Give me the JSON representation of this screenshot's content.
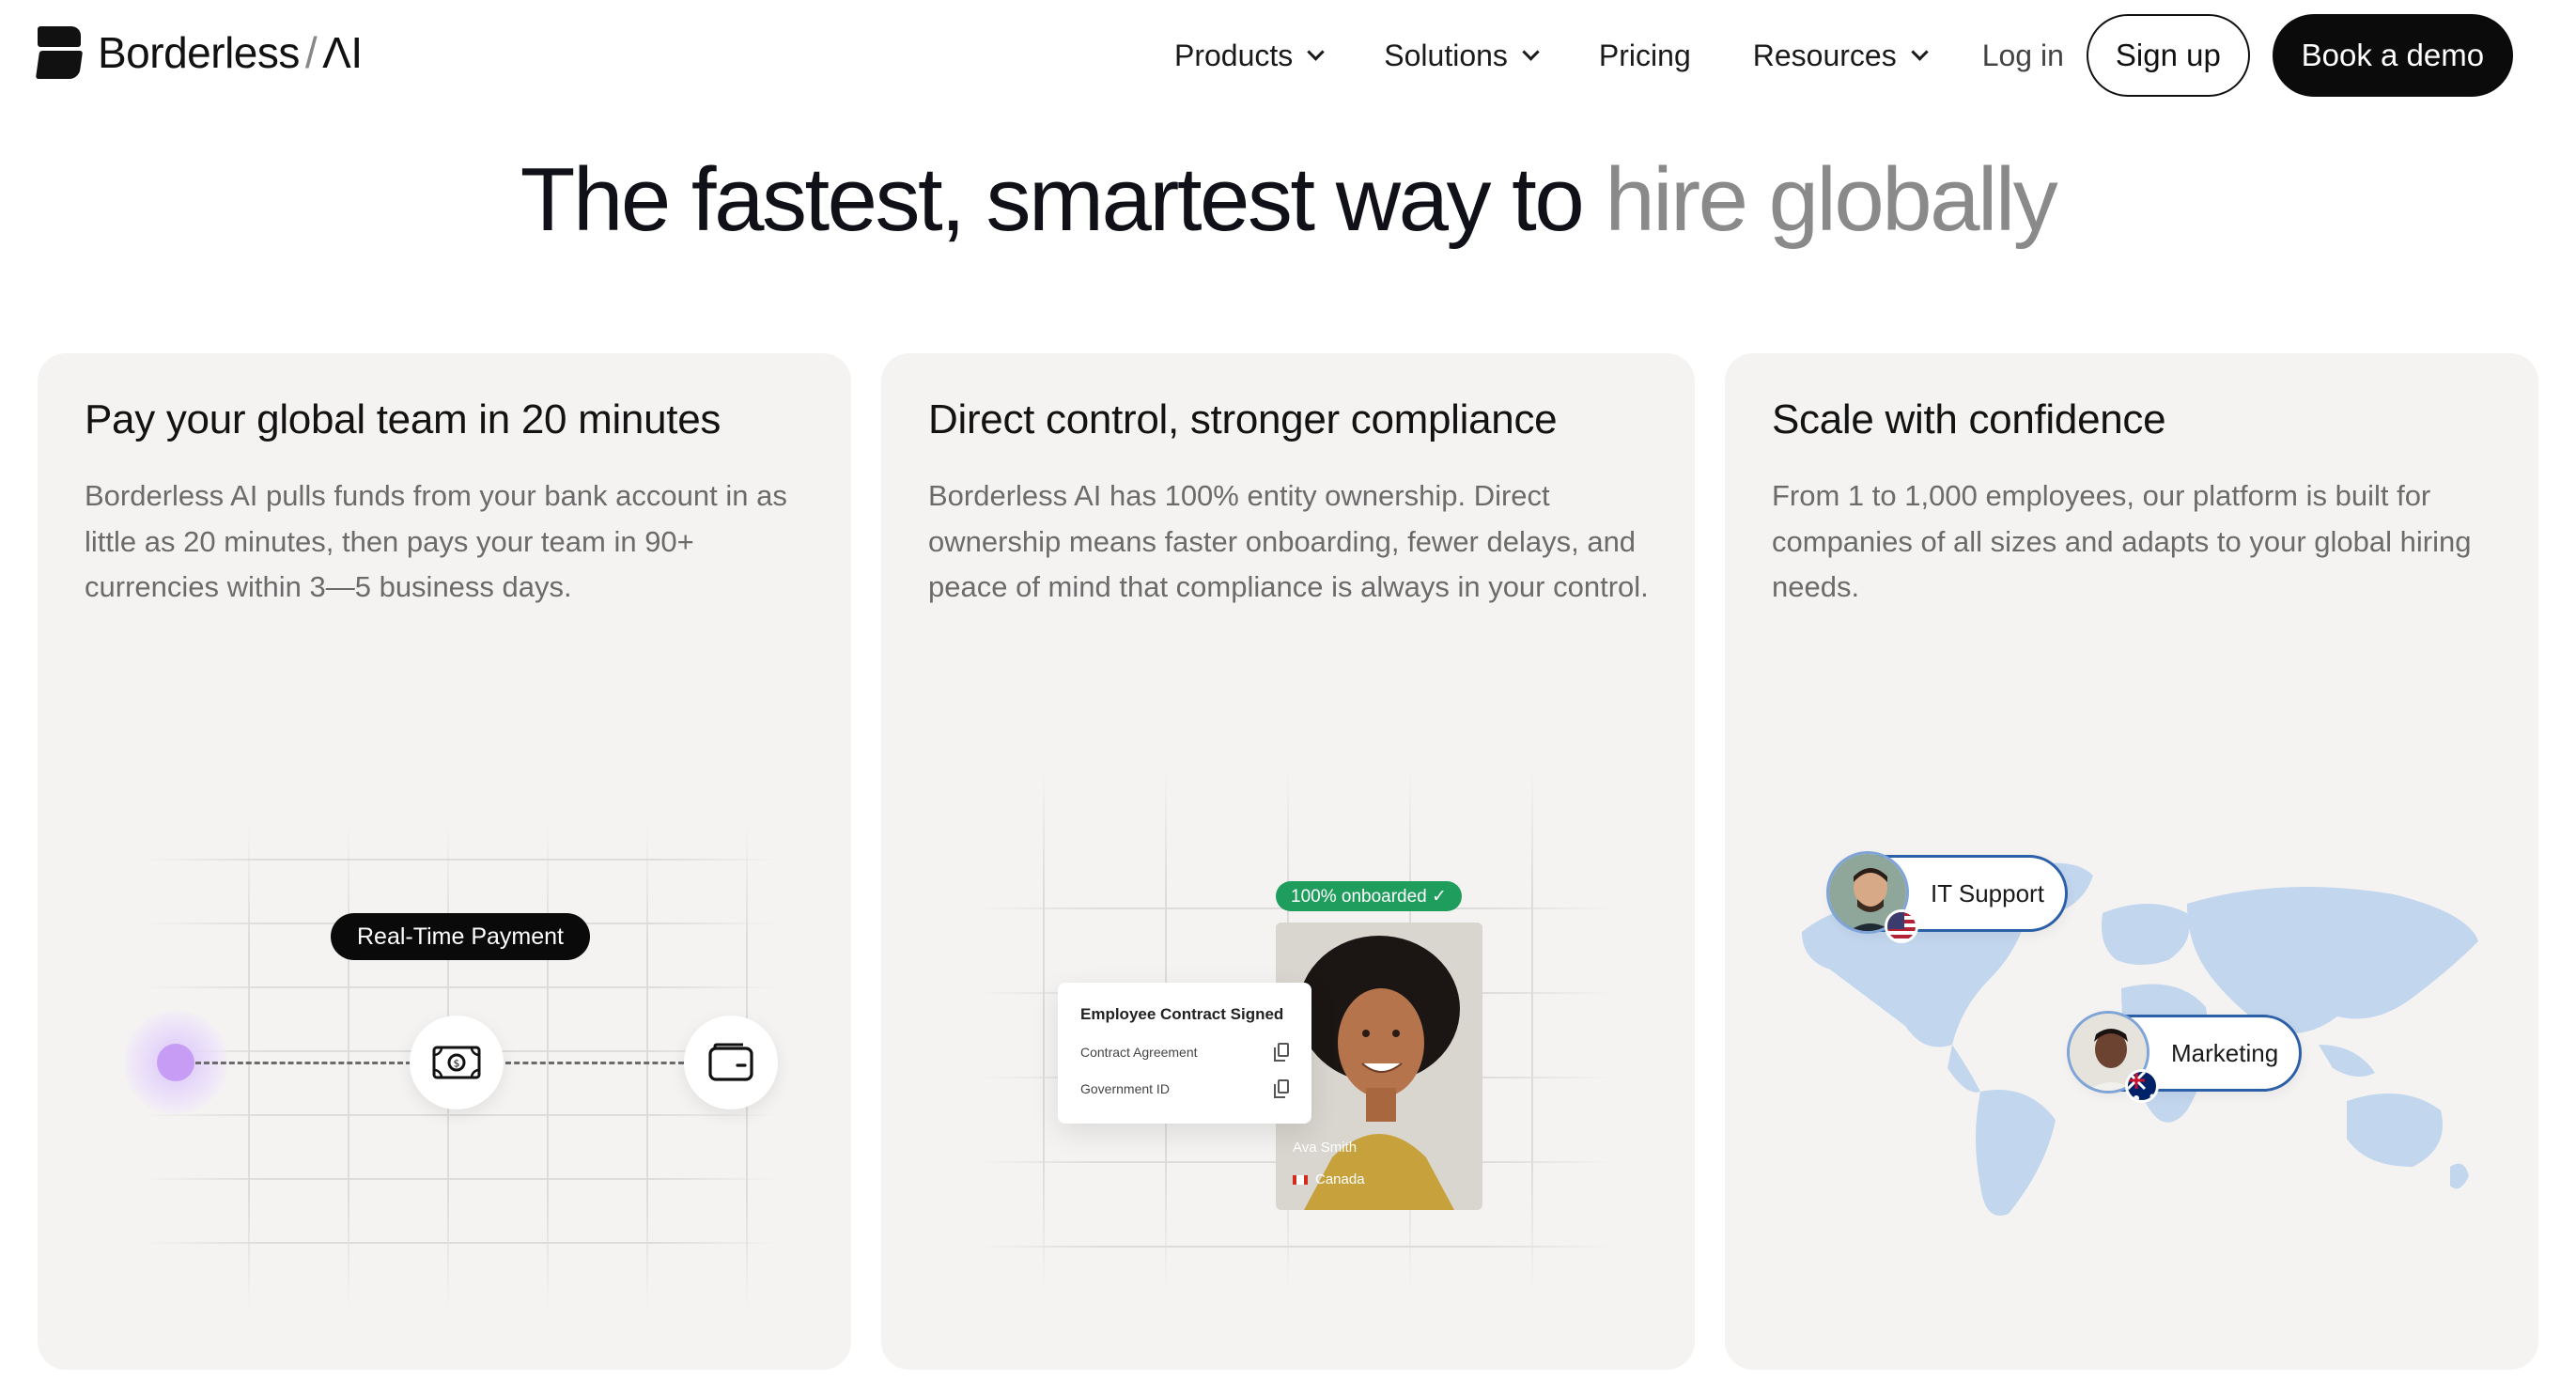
{
  "nav": {
    "logo_main": "Borderless",
    "logo_sep": "/",
    "logo_suffix": "ΛI",
    "items": [
      {
        "label": "Products"
      },
      {
        "label": "Solutions"
      },
      {
        "label": "Pricing"
      },
      {
        "label": "Resources"
      }
    ],
    "login": "Log in",
    "signup": "Sign up",
    "demo": "Book a demo"
  },
  "hero": {
    "headline_main": "The fastest, smartest way to ",
    "headline_accent": "hire globally"
  },
  "cards": [
    {
      "title": "Pay your global team in 20 minutes",
      "body": "Borderless AI pulls funds from your bank account in as little as 20 minutes, then pays your team in 90+ currencies within 3—5 business days.",
      "pill": "Real-Time Payment"
    },
    {
      "title": "Direct control, stronger compliance",
      "body": "Borderless AI has 100% entity ownership. Direct ownership means faster onboarding, fewer delays, and peace of mind that compliance is always in your control.",
      "badge": "100% onboarded ✓",
      "doc_title": "Employee Contract Signed",
      "doc_rows": [
        "Contract Agreement",
        "Government ID"
      ],
      "person_name": "Ava Smith",
      "person_country": "Canada"
    },
    {
      "title": "Scale with confidence",
      "body": "From 1 to 1,000 employees, our platform is built for companies of all sizes and adapts to your global hiring needs.",
      "tags": [
        "IT Support",
        "Marketing"
      ]
    }
  ],
  "colors": {
    "card_bg": "#f4f3f2",
    "accent_green": "#1e9d5c",
    "accent_purple": "#c79cf5",
    "map_blue": "#bcd3ee",
    "pill_border_blue": "#2b5fa8"
  }
}
